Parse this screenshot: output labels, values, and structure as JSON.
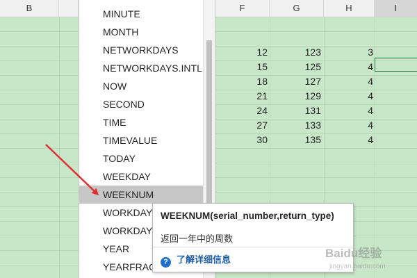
{
  "column_headers": [
    {
      "label": "B"
    },
    {
      "label": "F"
    },
    {
      "label": "G"
    },
    {
      "label": "H"
    },
    {
      "label": "I"
    }
  ],
  "cells": {
    "F": [
      "12",
      "15",
      "18",
      "21",
      "24",
      "27",
      "30"
    ],
    "G": [
      "123",
      "125",
      "127",
      "129",
      "131",
      "133",
      "135"
    ],
    "H": [
      "3",
      "4",
      "4",
      "4",
      "4",
      "4",
      "4"
    ]
  },
  "function_list": {
    "items": [
      "MINUTE",
      "MONTH",
      "NETWORKDAYS",
      "NETWORKDAYS.INTL",
      "NOW",
      "SECOND",
      "TIME",
      "TIMEVALUE",
      "TODAY",
      "WEEKDAY",
      "WEEKNUM",
      "WORKDAY",
      "WORKDAY",
      "YEAR",
      "YEARFRAC"
    ],
    "selected": "WEEKNUM"
  },
  "tooltip": {
    "signature": "WEEKNUM(serial_number,return_type)",
    "description": "返回一年中的周数",
    "help_icon": "question-circle-icon",
    "link_label": "了解详细信息"
  },
  "watermark": {
    "brand": "Baidu经验",
    "url": "jingyan.baidu.com"
  },
  "colors": {
    "grid_background": "#c8e6c8",
    "selection": "#c6c6c6",
    "link": "#1f5fa8",
    "annotation_arrow": "#e03030"
  }
}
